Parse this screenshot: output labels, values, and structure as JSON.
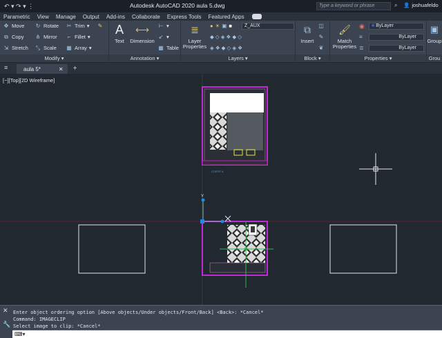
{
  "titlebar": {
    "title": "Autodesk AutoCAD 2020    aula 5.dwg",
    "search_placeholder": "Type a keyword or phrase",
    "username": "joshuafeldo"
  },
  "menu": {
    "tabs": [
      "Parametric",
      "View",
      "Manage",
      "Output",
      "Add-ins",
      "Collaborate",
      "Express Tools",
      "Featured Apps"
    ]
  },
  "ribbon": {
    "modify": {
      "title": "Modify",
      "move": "Move",
      "rotate": "Rotate",
      "trim": "Trim",
      "copy": "Copy",
      "mirror": "Mirror",
      "fillet": "Fillet",
      "stretch": "Stretch",
      "scale": "Scale",
      "array": "Array"
    },
    "annotation": {
      "title": "Annotation",
      "text": "Text",
      "dimension": "Dimension",
      "table": "Table"
    },
    "layers": {
      "title": "Layers",
      "layer_properties": "Layer\nProperties",
      "current_layer": "Z_AUX"
    },
    "block": {
      "title": "Block",
      "insert": "Insert"
    },
    "properties": {
      "title": "Properties",
      "match": "Match\nProperties",
      "color": "ByLayer",
      "linetype": "ByLayer",
      "lineweight": "ByLayer"
    },
    "groups": {
      "title": "Grou",
      "group": "Group"
    }
  },
  "doc": {
    "file_tab": "aula 5*"
  },
  "viewport": {
    "label": "[−][Top][2D Wireframe]"
  },
  "command": {
    "history": [
      "Enter object ordering option [Above objects/Under objects/Front/Back] <Back>: *Cancel*",
      "Command: IMAGECLIP",
      "Select image to clip: *Cancel*"
    ]
  },
  "colors": {
    "background": "#212830",
    "wall_magenta": "#c12bd3",
    "grip_blue": "#1e88e5",
    "ucs_green": "#2fb84a"
  }
}
